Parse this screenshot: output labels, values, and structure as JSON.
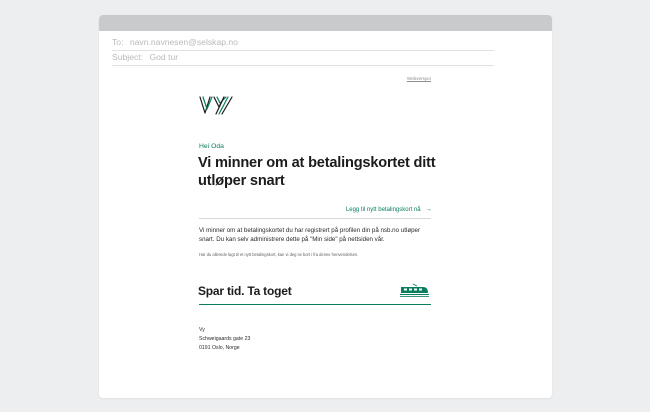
{
  "compose": {
    "to_label": "To:",
    "to_value": "navn.navnesen@selskap.no",
    "subject_label": "Subject:",
    "subject_value": "God tur"
  },
  "email": {
    "webversion_link": "Webversjon",
    "brand_logo_icon": "vy-logo-icon",
    "greeting": "Hei Oda",
    "headline": "Vi minner om at betalingskortet ditt utløper snart",
    "cta_link": "Legg til nytt betalingskort nå",
    "cta_arrow_icon": "arrow-right-icon",
    "body": "Vi minner om at betalingskortet du har registrert på profilen din på nsb.no utløper snart. Du kan selv administrere dette på \"Min side\" på nettsiden vår.",
    "note": "Har du allerede lagt til et nytt betalingskort, kan vi deg se bort i fra denne henvendelsen.",
    "tagline": "Spar tid. Ta toget",
    "train_icon": "train-icon",
    "address": {
      "name": "Vy",
      "street": "Schweigaards gate 23",
      "city": "0191 Oslo, Norge"
    }
  },
  "colors": {
    "brand_green": "#0a7d5f",
    "titlebar": "#c8cacc",
    "background": "#eceeef"
  }
}
